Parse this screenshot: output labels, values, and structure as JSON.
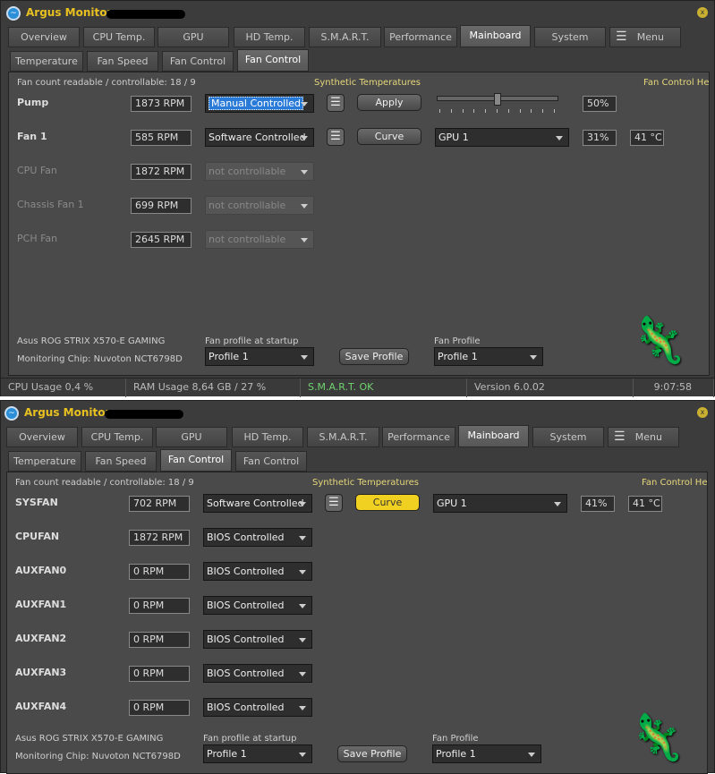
{
  "windows": [
    {
      "title": "Argus Monitor -",
      "main_tabs": [
        "Overview",
        "CPU Temp.",
        "GPU",
        "HD Temp.",
        "S.M.A.R.T.",
        "Performance",
        "Mainboard",
        "System",
        "Menu"
      ],
      "active_main_tab": 6,
      "sub_tabs": [
        "Temperature",
        "Fan Speed",
        "Fan Control",
        "Fan Control"
      ],
      "active_sub_tab": 3,
      "fan_count": "Fan count readable / controllable: 18 / 9",
      "synthetic": "Synthetic Temperatures",
      "help": "Fan Control Help",
      "fans": [
        {
          "name": "Pump",
          "rpm": "1873 RPM",
          "mode": "Manual Controlled",
          "enabled": true,
          "selected": true,
          "button": "Apply",
          "slider_percent": 50,
          "percent": "50%"
        },
        {
          "name": "Fan 1",
          "rpm": "585 RPM",
          "mode": "Software Controlled",
          "enabled": true,
          "button": "Curve",
          "source": "GPU 1",
          "percent": "31%",
          "temp": "41 °C"
        },
        {
          "name": "CPU Fan",
          "rpm": "1872 RPM",
          "mode": "not controllable",
          "enabled": false
        },
        {
          "name": "Chassis Fan 1",
          "rpm": "699 RPM",
          "mode": "not controllable",
          "enabled": false
        },
        {
          "name": "PCH Fan",
          "rpm": "2645 RPM",
          "mode": "not controllable",
          "enabled": false
        }
      ],
      "board": "Asus ROG STRIX X570-E GAMING",
      "chip": "Monitoring Chip: Nuvoton NCT6798D",
      "startup_label": "Fan profile at startup",
      "startup_value": "Profile 1",
      "save_label": "Save Profile",
      "profile_label": "Fan Profile",
      "profile_value": "Profile 1",
      "status": {
        "cpu": "CPU Usage 0,4 %",
        "ram": "RAM Usage 8,64 GB / 27 %",
        "smart": "S.M.A.R.T. OK",
        "version": "Version 6.0.02",
        "time": "9:07:58"
      }
    },
    {
      "title": "Argus Monitor -",
      "main_tabs": [
        "Overview",
        "CPU Temp.",
        "GPU",
        "HD Temp.",
        "S.M.A.R.T.",
        "Performance",
        "Mainboard",
        "System",
        "Menu"
      ],
      "active_main_tab": 6,
      "sub_tabs": [
        "Temperature",
        "Fan Speed",
        "Fan Control",
        "Fan Control"
      ],
      "active_sub_tab": 2,
      "fan_count": "Fan count readable / controllable: 18 / 9",
      "synthetic": "Synthetic Temperatures",
      "help": "Fan Control Help",
      "fans": [
        {
          "name": "SYSFAN",
          "rpm": "702 RPM",
          "mode": "Software Controlled",
          "enabled": true,
          "button": "Curve",
          "button_highlight": true,
          "source": "GPU 1",
          "percent": "41%",
          "temp": "41 °C"
        },
        {
          "name": "CPUFAN",
          "rpm": "1872 RPM",
          "mode": "BIOS Controlled",
          "enabled": true
        },
        {
          "name": "AUXFAN0",
          "rpm": "0 RPM",
          "mode": "BIOS Controlled",
          "enabled": true
        },
        {
          "name": "AUXFAN1",
          "rpm": "0 RPM",
          "mode": "BIOS Controlled",
          "enabled": true
        },
        {
          "name": "AUXFAN2",
          "rpm": "0 RPM",
          "mode": "BIOS Controlled",
          "enabled": true
        },
        {
          "name": "AUXFAN3",
          "rpm": "0 RPM",
          "mode": "BIOS Controlled",
          "enabled": true
        },
        {
          "name": "AUXFAN4",
          "rpm": "0 RPM",
          "mode": "BIOS Controlled",
          "enabled": true
        }
      ],
      "board": "Asus ROG STRIX X570-E GAMING",
      "chip": "Monitoring Chip: Nuvoton NCT6798D",
      "startup_label": "Fan profile at startup",
      "startup_value": "Profile 1",
      "save_label": "Save Profile",
      "profile_label": "Fan Profile",
      "profile_value": "Profile 1"
    }
  ]
}
